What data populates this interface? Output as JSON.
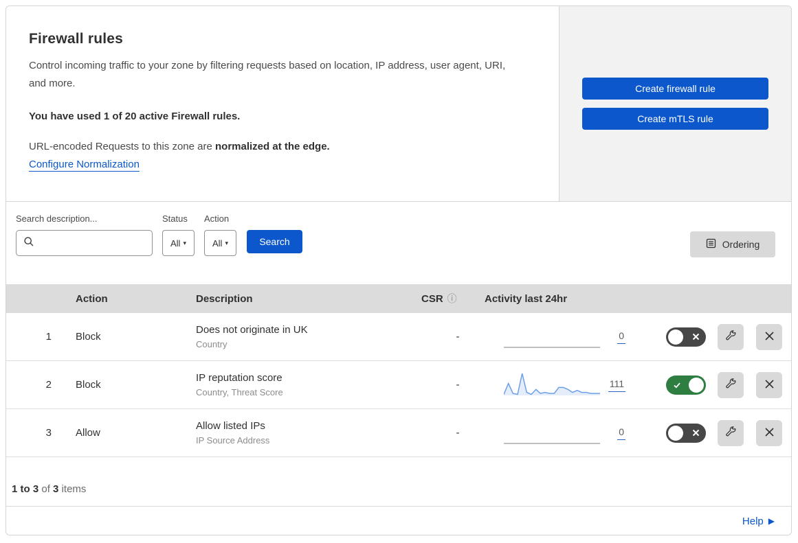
{
  "header": {
    "title": "Firewall rules",
    "description": "Control incoming traffic to your zone by filtering requests based on location, IP address, user agent, URI, and more.",
    "usage": "You have used 1 of 20 active Firewall rules.",
    "normalization_prefix": "URL-encoded Requests to this zone are ",
    "normalization_bold": "normalized at the edge.",
    "normalization_link": "Configure Normalization",
    "create_firewall_button": "Create firewall rule",
    "create_mtls_button": "Create mTLS rule"
  },
  "filters": {
    "search_label": "Search description...",
    "status_label": "Status",
    "status_value": "All",
    "action_label": "Action",
    "action_value": "All",
    "search_button": "Search",
    "ordering_button": "Ordering"
  },
  "table": {
    "columns": {
      "action": "Action",
      "description": "Description",
      "csr": "CSR",
      "activity": "Activity last 24hr"
    },
    "rows": [
      {
        "num": "1",
        "action": "Block",
        "title": "Does not originate in UK",
        "subtitle": "Country",
        "csr": "-",
        "count": "0",
        "enabled": false,
        "sparkline": []
      },
      {
        "num": "2",
        "action": "Block",
        "title": "IP reputation score",
        "subtitle": "Country, Threat Score",
        "csr": "-",
        "count": "111",
        "enabled": true,
        "sparkline": [
          1,
          12,
          2,
          1,
          22,
          3,
          1,
          6,
          2,
          3,
          2,
          2,
          8,
          8,
          6,
          3,
          5,
          3,
          3,
          2,
          2,
          2
        ]
      },
      {
        "num": "3",
        "action": "Allow",
        "title": "Allow listed IPs",
        "subtitle": "IP Source Address",
        "csr": "-",
        "count": "0",
        "enabled": false,
        "sparkline": []
      }
    ]
  },
  "footer": {
    "range": "1 to 3",
    "of_text": "of",
    "total": "3",
    "items_text": "items",
    "help_label": "Help"
  },
  "colors": {
    "primary_blue": "#0b57cb",
    "toggle_on_green": "#2e7d41",
    "toggle_off_dark": "#474747",
    "sparkline_blue": "#6d9fe8",
    "sparkline_fill": "rgba(110,155,230,0.18)",
    "flat_line_gray": "#9a9a9a"
  }
}
